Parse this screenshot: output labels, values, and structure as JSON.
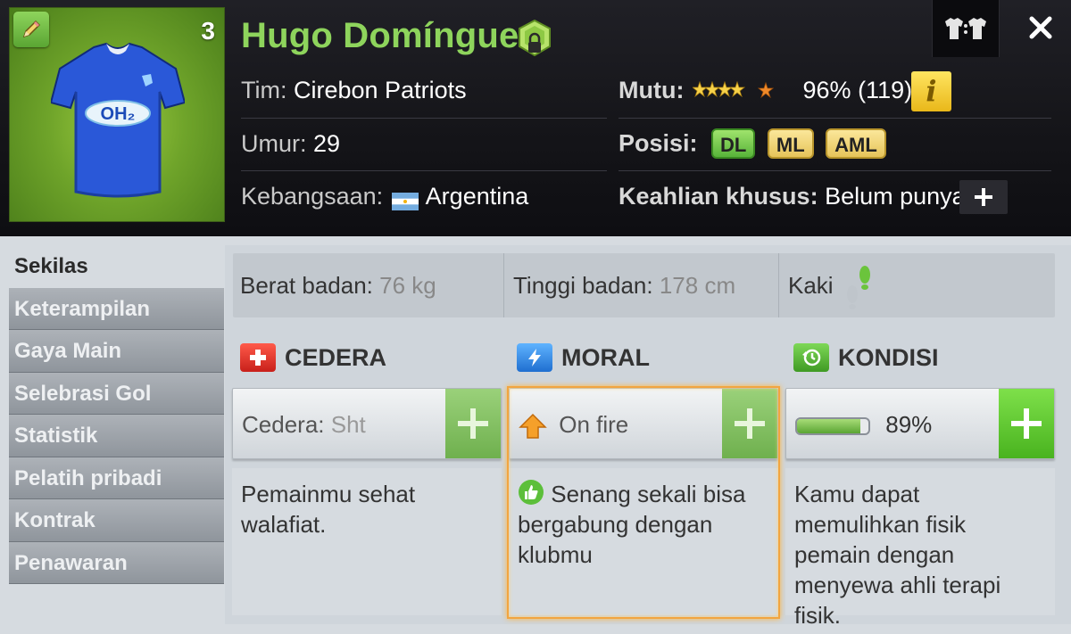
{
  "player": {
    "name": "Hugo Domínguez",
    "shirt_number": "3",
    "jersey_sponsor": "OH₂"
  },
  "header_info": {
    "team_label": "Tim:",
    "team_value": "Cirebon Patriots",
    "age_label": "Umur:",
    "age_value": "29",
    "nationality_label": "Kebangsaan:",
    "nationality_value": "Argentina",
    "quality_label": "Mutu:",
    "quality_percent": "96%",
    "quality_value": "(119)",
    "quality_stars": 4.5,
    "position_label": "Posisi:",
    "positions": [
      "DL",
      "ML",
      "AML"
    ],
    "special_skill_label": "Keahlian khusus:",
    "special_skill_value": "Belum punya",
    "info_button": "i"
  },
  "sidebar": {
    "items": [
      {
        "label": "Sekilas",
        "active": true
      },
      {
        "label": "Keterampilan",
        "active": false
      },
      {
        "label": "Gaya Main",
        "active": false
      },
      {
        "label": "Selebrasi Gol",
        "active": false
      },
      {
        "label": "Statistik",
        "active": false
      },
      {
        "label": "Pelatih pribadi",
        "active": false
      },
      {
        "label": "Kontrak",
        "active": false
      },
      {
        "label": "Penawaran",
        "active": false
      }
    ]
  },
  "stats": {
    "weight_label": "Berat badan:",
    "weight_value": "76 kg",
    "height_label": "Tinggi badan:",
    "height_value": "178 cm",
    "foot_label": "Kaki"
  },
  "panels": {
    "injury": {
      "title": "CEDERA",
      "status_label": "Cedera:",
      "status_value": "Sht",
      "description": "Pemainmu sehat walafiat."
    },
    "morale": {
      "title": "MORAL",
      "status_value": "On fire",
      "description": "Senang sekali bisa bergabung dengan klubmu"
    },
    "condition": {
      "title": "KONDISI",
      "status_value": "89%",
      "level": 0.89,
      "description": "Kamu dapat memulihkan fisik pemain dengan menyewa ahli terapi fisik."
    }
  },
  "colors": {
    "name_green": "#8ed45c",
    "position_primary": "#58b43a",
    "position_secondary": "#e6c45a",
    "fire_border": "#f2a540"
  }
}
